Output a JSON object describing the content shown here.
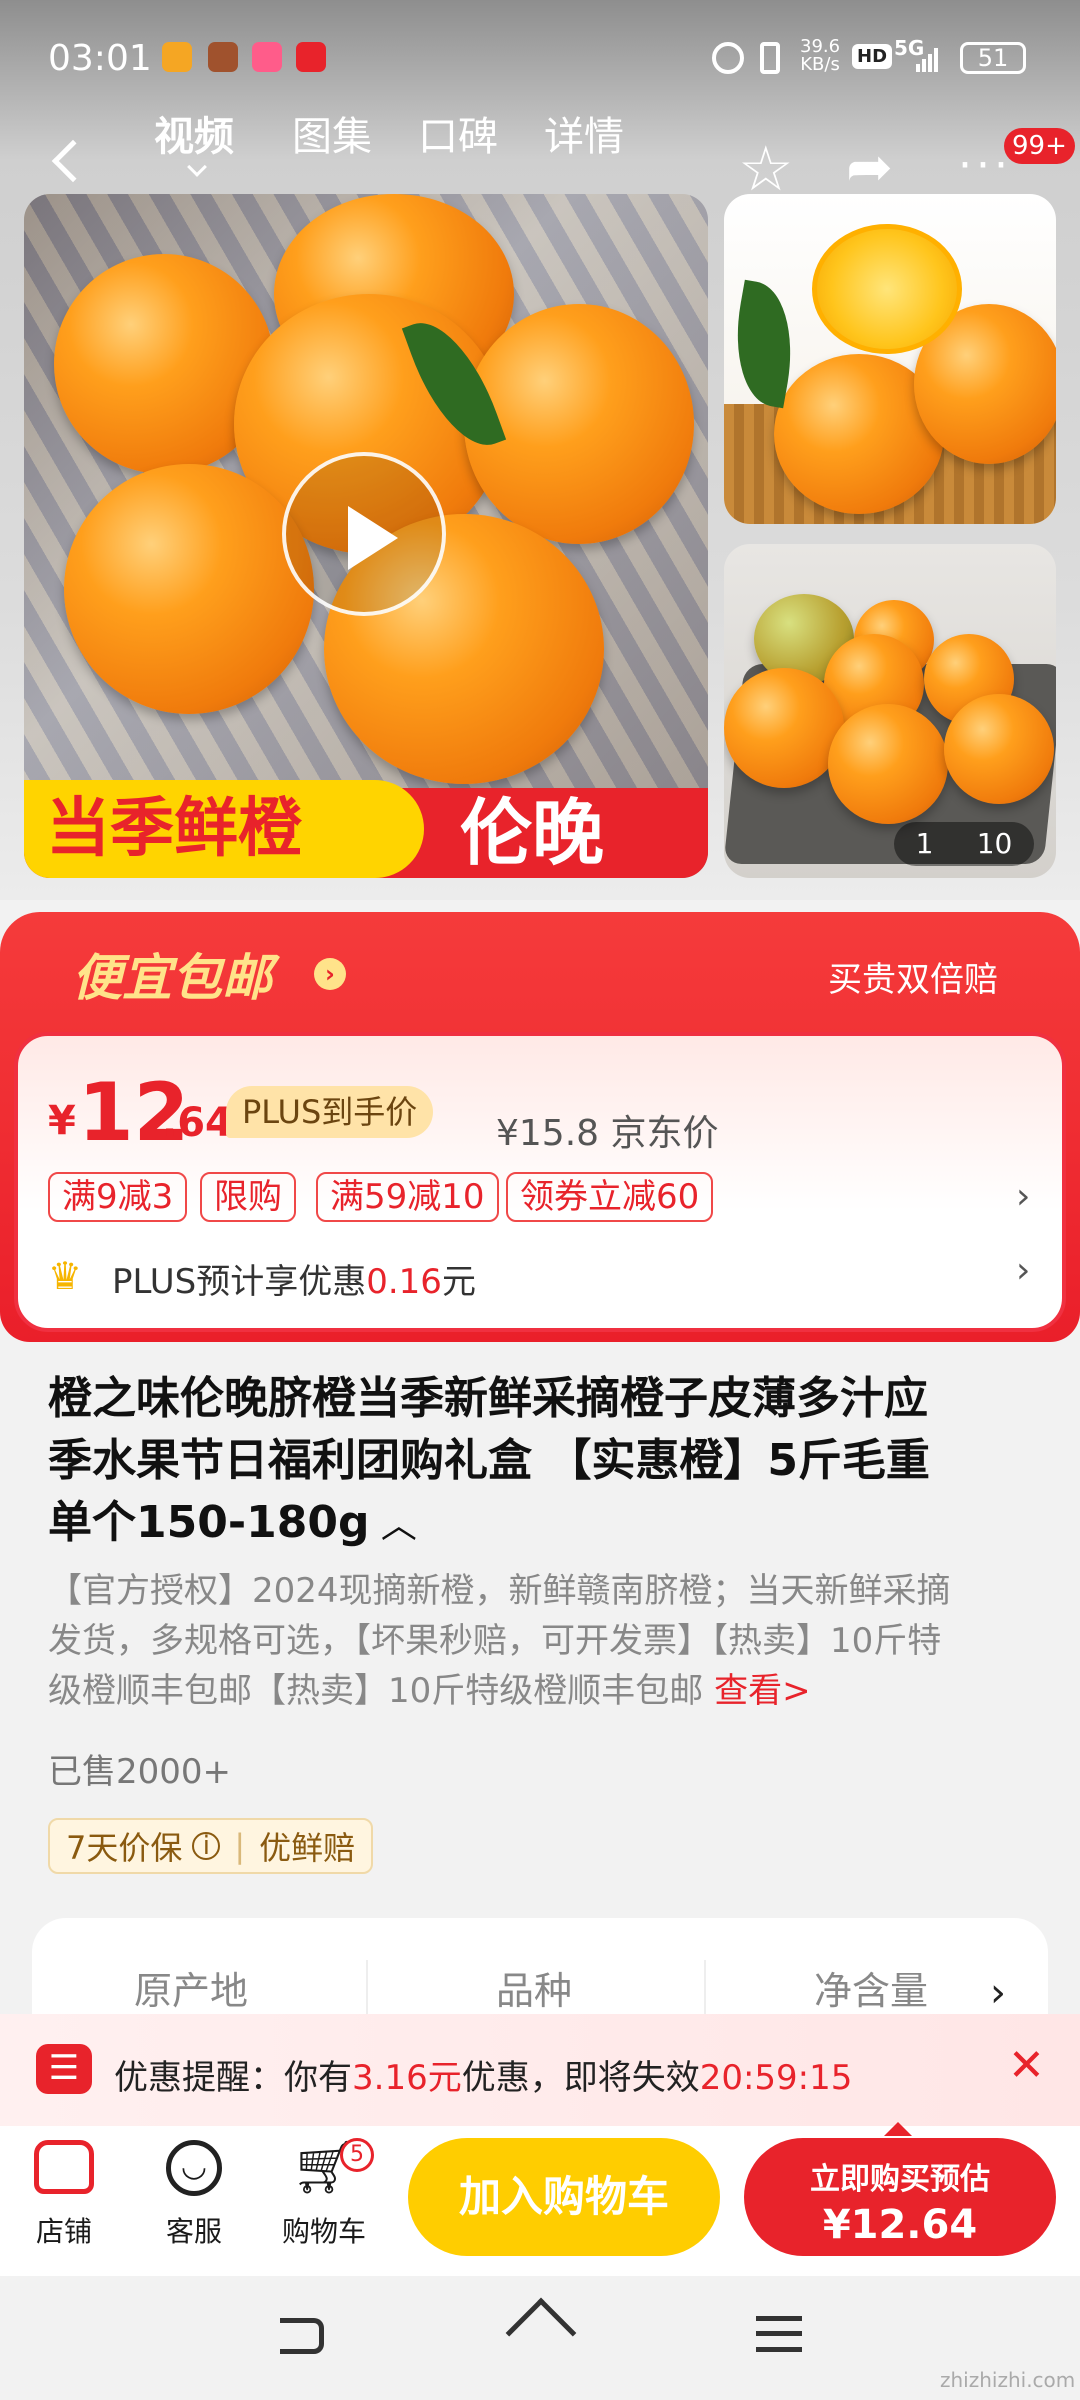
{
  "status": {
    "time": "03:01",
    "speed": "39.6",
    "speed_unit": "KB/s",
    "hd": "HD",
    "net": "5G",
    "battery": "51"
  },
  "header": {
    "tabs": [
      "视频",
      "图集",
      "口碑",
      "详情"
    ],
    "badge": "99+"
  },
  "gallery": {
    "banner_left": "当季鲜橙",
    "banner_right": "伦晚",
    "page_current": "1",
    "page_total": "10"
  },
  "promo": {
    "title": "便宜包邮",
    "right": "买贵双倍赔",
    "price_symbol": "¥",
    "price_int": "12",
    "price_dec": ".64",
    "plus_tag": "PLUS到手价",
    "jd_price": "¥15.8 京东价",
    "coupons": [
      "满9减3",
      "限购",
      "满59减10",
      "领券立减60"
    ],
    "plus_line_prefix": "PLUS预计享优惠",
    "plus_line_amount": "0.16",
    "plus_line_suffix": "元"
  },
  "product": {
    "title_1": "橙之味伦晚脐橙当季新鲜采摘橙子皮薄多汁应",
    "title_2": "季水果节日福利团购礼盒 【实惠橙】5斤毛重",
    "title_3": "单个150-180g",
    "desc_1": "【官方授权】2024现摘新橙，新鲜赣南脐橙；当天新鲜采摘",
    "desc_2": "发货，多规格可选，【坏果秒赔，可开发票】【热卖】10斤特",
    "desc_3": "级橙顺丰包邮【热卖】10斤特级橙顺丰包邮",
    "desc_more": "查看>",
    "sold": "已售2000+",
    "guarantee_1": "7天价保",
    "guarantee_2": "优鲜赔"
  },
  "specs": [
    "原产地",
    "品种",
    "净含量"
  ],
  "reminder": {
    "prefix": "优惠提醒：你有",
    "amount": "3.16元",
    "middle": "优惠，即将失效",
    "timer": "20:59:15"
  },
  "bottom": {
    "store": "店铺",
    "service": "客服",
    "cart": "购物车",
    "cart_count": "5",
    "add_cart": "加入购物车",
    "buy_line1": "立即购买预估",
    "buy_line2": "¥12.64"
  },
  "watermark": "zhizhizhi.com",
  "colors": {
    "accent": "#e8232b",
    "yellow": "#ffce00",
    "gold": "#ffe38a"
  }
}
